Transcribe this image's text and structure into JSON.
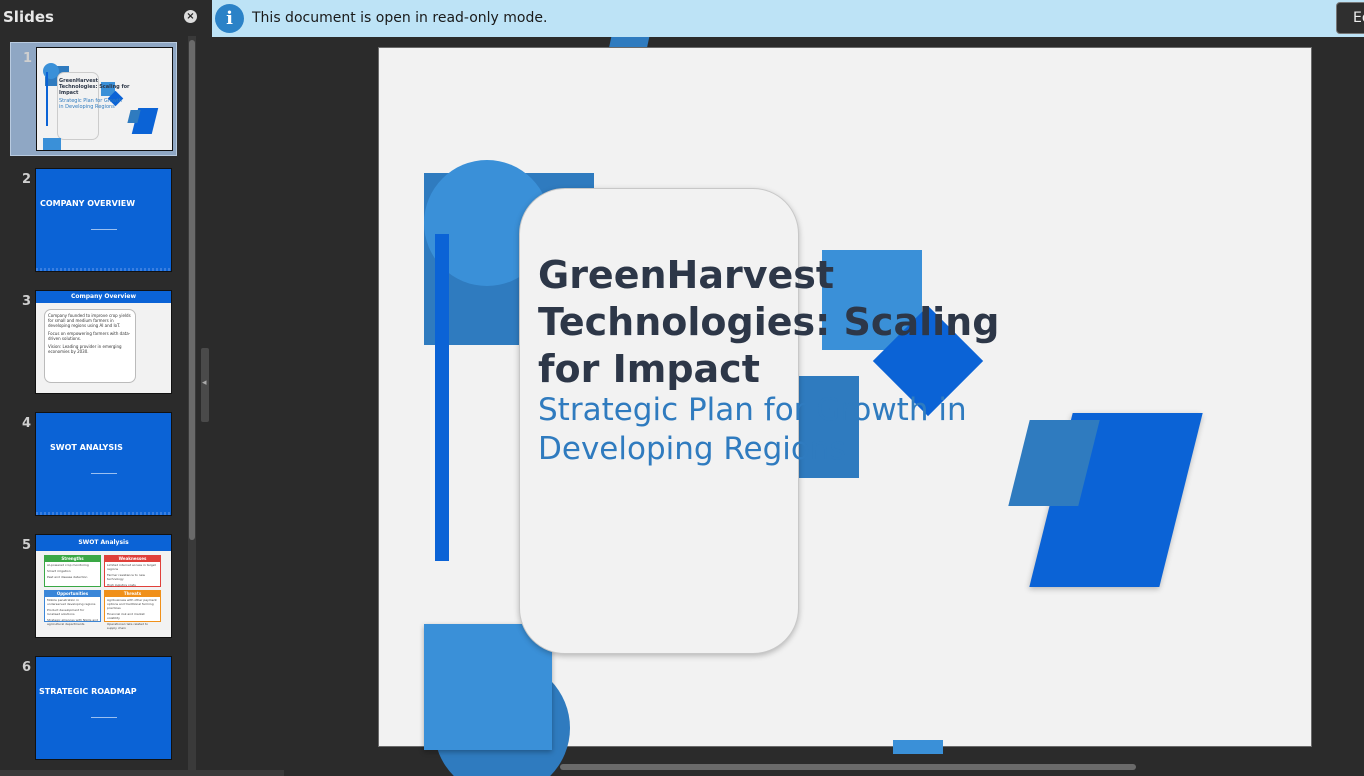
{
  "slides_pane": {
    "title": "Slides",
    "items": [
      {
        "number": "1",
        "title": "GreenHarvest Technologies: Scaling for Impact",
        "subtitle": "Strategic Plan for Growth in Developing Regions"
      },
      {
        "number": "2",
        "title": "COMPANY OVERVIEW"
      },
      {
        "number": "3",
        "title": "Company Overview",
        "bullets": [
          "Company founded to improve crop yields for small and medium farmers in developing regions using AI and IoT.",
          "Focus on empowering farmers with data-driven solutions.",
          "Vision: Leading provider in emerging economies by 2030."
        ]
      },
      {
        "number": "4",
        "title": "SWOT ANALYSIS"
      },
      {
        "number": "5",
        "title": "SWOT Analysis",
        "boxes": [
          {
            "label": "Strengths",
            "color": "#3aa845",
            "lines": [
              "AI-powered crop monitoring",
              "Smart irrigation",
              "Pest and disease detection"
            ]
          },
          {
            "label": "Weaknesses",
            "color": "#e0403a",
            "lines": [
              "Limited internet access in target regions",
              "Farmer resistance to new technology",
              "High logistics costs"
            ]
          },
          {
            "label": "Opportunities",
            "color": "#3a86d8",
            "lines": [
              "Mobile penetration in underserved developing regions",
              "Product development for localised solutions",
              "Strategic alliances with NGOs and agricultural departments"
            ]
          },
          {
            "label": "Threats",
            "color": "#f0901a",
            "lines": [
              "Agribusiness with other payment options and traditional farming practices",
              "Financial risk and market volatility",
              "Operational risks related to supply chain"
            ]
          }
        ]
      },
      {
        "number": "6",
        "title": "STRATEGIC ROADMAP"
      }
    ]
  },
  "infobar": {
    "message": "This document is open in read-only mode.",
    "edit_label": "Ed"
  },
  "main_slide": {
    "title": "GreenHarvest Technologies: Scaling for Impact",
    "subtitle": "Strategic Plan for Growth in Developing Regions"
  },
  "colors": {
    "accent_blue": "#0b63d6",
    "mid_blue": "#2f7bbf",
    "light_blue": "#3a90d8",
    "infobar": "#bde3f6"
  }
}
